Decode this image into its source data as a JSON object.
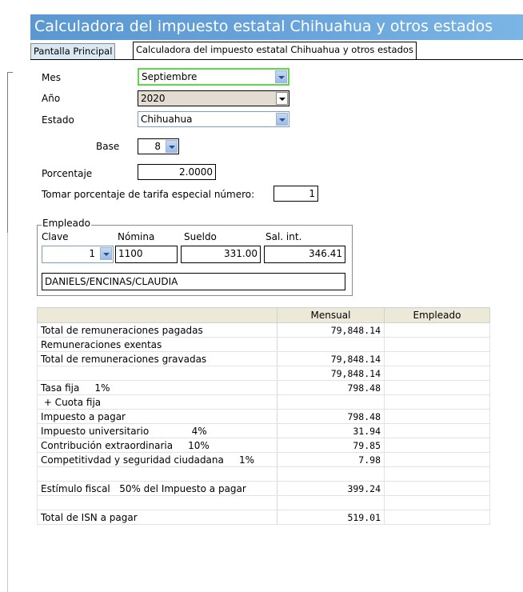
{
  "window": {
    "title": "Calculadora del impuesto estatal Chihuahua y otros estados"
  },
  "tabs": [
    {
      "label": "Pantalla Principal"
    },
    {
      "label": "Calculadora del impuesto estatal Chihuahua y otros estados"
    }
  ],
  "form": {
    "mes_label": "Mes",
    "mes_value": "Septiembre",
    "anio_label": "Año",
    "anio_value": "2020",
    "estado_label": "Estado",
    "estado_value": "Chihuahua",
    "base_label": "Base",
    "base_value": "8",
    "porcentaje_label": "Porcentaje",
    "porcentaje_value": "2.0000",
    "tarifa_label": "Tomar porcentaje de tarifa especial número:",
    "tarifa_value": "1"
  },
  "empleado": {
    "group_title": "Empleado",
    "clave_label": "Clave",
    "clave_value": "1",
    "nomina_label": "Nómina",
    "nomina_value": "1100",
    "sueldo_label": "Sueldo",
    "sueldo_value": "331.00",
    "salint_label": "Sal. int.",
    "salint_value": "346.41",
    "nombre": "DANIELS/ENCINAS/CLAUDIA"
  },
  "grid": {
    "headers": [
      "",
      "Mensual",
      "Empleado"
    ],
    "rows": [
      {
        "concepto": "Total de remuneraciones pagadas",
        "mensual": "79,848.14",
        "empleado": ""
      },
      {
        "concepto": "Remuneraciones exentas",
        "mensual": "",
        "empleado": ""
      },
      {
        "concepto": "Total de remuneraciones gravadas",
        "mensual": "79,848.14",
        "empleado": ""
      },
      {
        "concepto": "",
        "mensual": "79,848.14",
        "empleado": ""
      },
      {
        "concepto": "Tasa fija     1%",
        "mensual": "798.48",
        "empleado": ""
      },
      {
        "concepto": " + Cuota fija",
        "mensual": "",
        "empleado": ""
      },
      {
        "concepto": "Impuesto a pagar",
        "mensual": "798.48",
        "empleado": ""
      },
      {
        "concepto": "Impuesto universitario              4%",
        "mensual": "31.94",
        "empleado": ""
      },
      {
        "concepto": "Contribución extraordinaria     10%",
        "mensual": "79.85",
        "empleado": ""
      },
      {
        "concepto": "Competitivdad y seguridad ciudadana     1%",
        "mensual": "7.98",
        "empleado": ""
      },
      {
        "concepto": "",
        "mensual": "",
        "empleado": ""
      },
      {
        "concepto": "Estímulo fiscal   50% del Impuesto a pagar",
        "mensual": "399.24",
        "empleado": ""
      },
      {
        "concepto": "",
        "mensual": "",
        "empleado": ""
      },
      {
        "concepto": "Total de ISN a pagar",
        "mensual": "519.01",
        "empleado": ""
      }
    ]
  }
}
